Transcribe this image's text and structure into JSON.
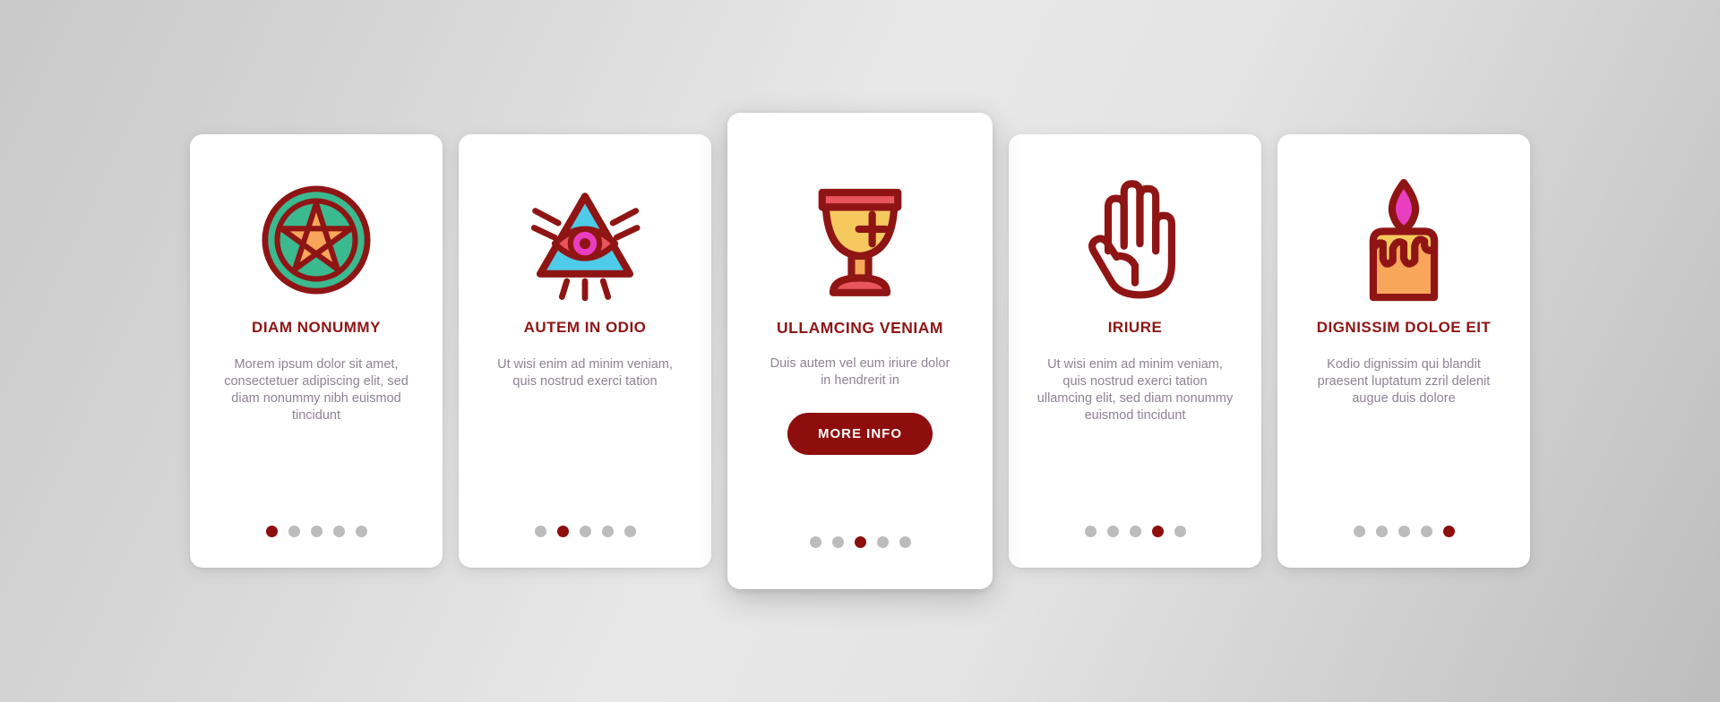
{
  "theme": {
    "accent_dark_red": "#8e0d0d",
    "title_red": "#8f1515",
    "body_gray": "#8d8392",
    "dot_inactive": "#bcbcbc",
    "card_bg": "#ffffff",
    "icon_outline": "#8f1515",
    "icon_teal": "#3bb98f",
    "icon_orange": "#f7a65a",
    "icon_cyan": "#4ecbe8",
    "icon_magenta": "#ea3ec0",
    "icon_crimson": "#e8555a",
    "icon_gold": "#f6c95e"
  },
  "cards": [
    {
      "id": "card-pentagram",
      "icon": "pentagram-icon",
      "title": "DIAM NONUMMY",
      "body": "Morem ipsum dolor sit amet, consectetuer adipiscing elit, sed diam nonummy nibh euismod tincidunt",
      "featured": false,
      "dots": {
        "count": 5,
        "active_index": 0
      }
    },
    {
      "id": "card-all-seeing-eye",
      "icon": "all-seeing-eye-icon",
      "title": "AUTEM IN ODIO",
      "body": "Ut wisi enim ad minim veniam, quis nostrud exerci tation",
      "featured": false,
      "dots": {
        "count": 5,
        "active_index": 1
      }
    },
    {
      "id": "card-chalice",
      "icon": "chalice-icon",
      "title": "ULLAMCING VENIAM",
      "body": "Duis autem vel eum iriure dolor in hendrerit in",
      "featured": true,
      "button_label": "MORE INFO",
      "dots": {
        "count": 5,
        "active_index": 2
      }
    },
    {
      "id": "card-hand",
      "icon": "hand-palm-icon",
      "title": "IRIURE",
      "body": "Ut wisi enim ad minim veniam, quis nostrud exerci tation ullamcing elit, sed diam nonummy euismod tincidunt",
      "featured": false,
      "dots": {
        "count": 5,
        "active_index": 3
      }
    },
    {
      "id": "card-candle",
      "icon": "candle-icon",
      "title": "DIGNISSIM DOLOE EIT",
      "body": "Kodio dignissim qui blandit praesent luptatum zzril delenit augue duis dolore",
      "featured": false,
      "dots": {
        "count": 5,
        "active_index": 4
      }
    }
  ]
}
